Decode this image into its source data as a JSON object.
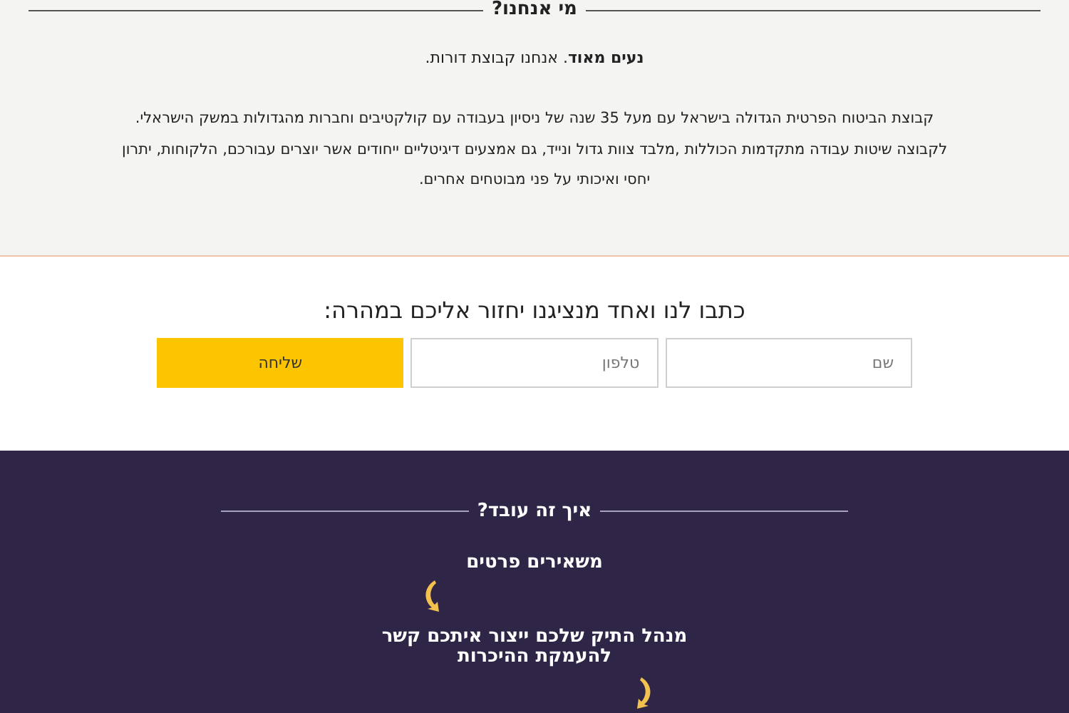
{
  "about": {
    "title": "מי אנחנו?",
    "intro": "**נעים מאוד**. אנחנו קבוצת דורות.",
    "paragraph": "קבוצת הביטוח הפרטית הגדולה בישראל עם מעל 35 שנה של ניסיון בעבודה עם קולקטיבים וחברות מהגדולות במשק הישראלי. לקבוצה שיטות עבודה מתקדמות הכוללות ,מלבד צוות גדול ונייד, גם אמצעים דיגיטליים ייחודים אשר יוצרים עבורכם, הלקוחות, יתרון יחסי ואיכותי על פני מבוטחים אחרים."
  },
  "contact": {
    "title": "כתבו לנו ואחד מנציגנו יחזור אליכם במהרה:",
    "fields": [
      {
        "placeholder": "שם"
      },
      {
        "placeholder": "טלפון"
      }
    ],
    "submit": "שליחה"
  },
  "how": {
    "title": "איך זה עובד?",
    "steps": [
      {
        "text": "משאירים פרטים"
      },
      {
        "text": "מנהל התיק שלכם ייצור איתכם קשר להעמקת ההיכרות"
      }
    ]
  }
}
